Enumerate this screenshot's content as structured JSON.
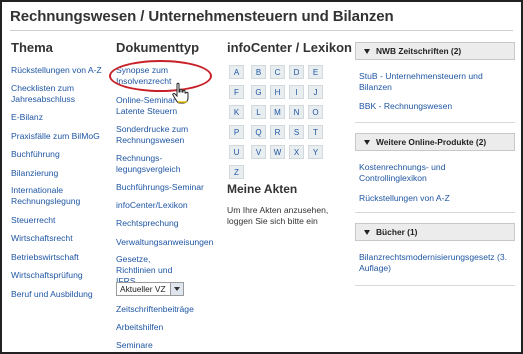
{
  "page": {
    "title": "Rechnungswesen / Unternehmensteuern und Bilanzen"
  },
  "thema": {
    "heading": "Thema",
    "items": [
      "Rückstellungen von A-Z",
      "Checklisten zum Jahresabschluss",
      "E-Bilanz",
      "Praxisfälle zum BilMoG",
      "Buchführung",
      "Bilanzierung",
      "Internationale Rechnungslegung",
      "Steuerrecht",
      "Wirtschaftsrecht",
      "Betriebswirtschaft",
      "Wirtschaftsprüfung",
      "Beruf und Ausbildung"
    ]
  },
  "dokumenttyp": {
    "heading": "Dokumenttyp",
    "items": [
      "Synopse zum Insolvenzrecht",
      "Online-Seminar Latente Steuern",
      "Sonderdrucke zum Rechnungswesen",
      "Rechnungs-legungsvergleich",
      "Buchführungs-Seminar",
      "infoCenter/Lexikon",
      "Rechtsprechung",
      "Verwaltungsanweisungen",
      "Gesetze, Richtlinien und IFRS",
      "Zeitschriftenbeiträge",
      "Arbeitshilfen",
      "Seminare"
    ],
    "select_value": "Aktueller VZ"
  },
  "infocenter": {
    "heading": "infoCenter / Lexikon",
    "letters": [
      "A",
      "B",
      "C",
      "D",
      "E",
      "F",
      "G",
      "H",
      "I",
      "J",
      "K",
      "L",
      "M",
      "N",
      "O",
      "P",
      "Q",
      "R",
      "S",
      "T",
      "U",
      "V",
      "W",
      "X",
      "Y",
      "Z"
    ]
  },
  "akten": {
    "heading": "Meine Akten",
    "text": "Um Ihre Akten anzusehen, loggen Sie sich bitte ein"
  },
  "sidebar": {
    "boxes": [
      {
        "title": "NWB Zeitschriften (2)",
        "items": [
          "StuB - Unternehmensteuern und Bilanzen",
          "BBK - Rechnungswesen"
        ]
      },
      {
        "title": "Weitere Online-Produkte (2)",
        "items": [
          "Kostenrechnungs- und Controllinglexikon",
          "Rückstellungen von A-Z"
        ]
      },
      {
        "title": "Bücher (1)",
        "items": [
          "Bilanzrechtsmodernisierungsgesetz (3. Auflage)"
        ]
      }
    ]
  },
  "colors": {
    "link": "#1f56a3",
    "highlight": "#c72127",
    "box_header_bg": "#ececec"
  }
}
